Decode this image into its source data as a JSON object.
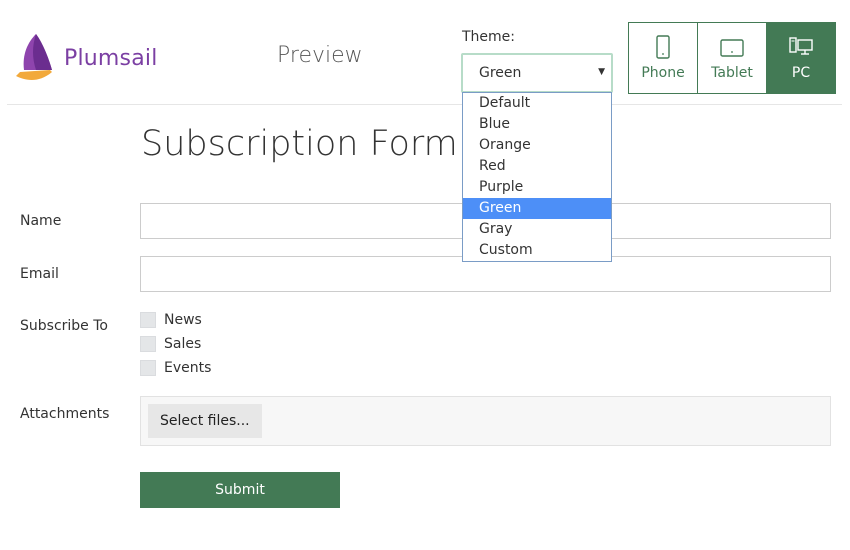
{
  "header": {
    "logo_text": "Plumsail",
    "preview_title": "Preview",
    "theme_label": "Theme:",
    "theme_selected": "Green",
    "theme_options": [
      "Default",
      "Blue",
      "Orange",
      "Red",
      "Purple",
      "Green",
      "Gray",
      "Custom"
    ],
    "devices": [
      {
        "label": "Phone",
        "icon": "phone-icon",
        "active": false
      },
      {
        "label": "Tablet",
        "icon": "tablet-icon",
        "active": false
      },
      {
        "label": "PC",
        "icon": "desktop-icon",
        "active": true
      }
    ]
  },
  "form": {
    "title": "Subscription Form",
    "name_label": "Name",
    "name_value": "",
    "email_label": "Email",
    "email_value": "",
    "subscribe_label": "Subscribe To",
    "subscribe_options": [
      "News",
      "Sales",
      "Events"
    ],
    "attachments_label": "Attachments",
    "select_files_label": "Select files...",
    "submit_label": "Submit"
  },
  "colors": {
    "accent_green": "#437a55",
    "brand_purple": "#7b3fa3",
    "brand_orange": "#f2a93b",
    "dropdown_highlight": "#4d8ff7"
  }
}
